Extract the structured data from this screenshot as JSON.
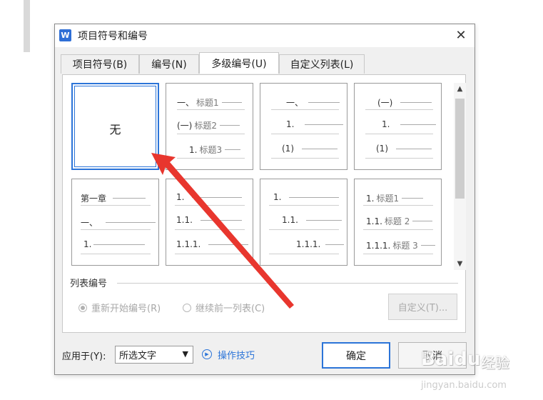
{
  "dialog": {
    "app_icon": "W",
    "title": "项目符号和编号",
    "close": "✕"
  },
  "tabs": [
    {
      "label": "项目符号(B)",
      "active": false
    },
    {
      "label": "编号(N)",
      "active": false
    },
    {
      "label": "多级编号(U)",
      "active": true
    },
    {
      "label": "自定义列表(L)",
      "active": false
    }
  ],
  "gallery": {
    "none_label": "无",
    "cell2": [
      "一、",
      "标题1",
      "(一)",
      "标题2",
      "1.",
      "标题3"
    ],
    "cell3": [
      "一、",
      "1.",
      "(1)"
    ],
    "cell4": [
      "(一)",
      "1.",
      "(1)"
    ],
    "cell5": [
      "第一章",
      "一、",
      "1."
    ],
    "cell6": [
      "1.",
      "1.1.",
      "1.1.1."
    ],
    "cell7": [
      "1.",
      "1.1.",
      "1.1.1."
    ],
    "cell8": [
      "1.",
      "标题1",
      "1.1.",
      "标题 2",
      "1.1.1.",
      "标题 3"
    ]
  },
  "list_numbering": {
    "section_label": "列表编号",
    "restart_label": "重新开始编号(R)",
    "continue_label": "继续前一列表(C)",
    "custom_button": "自定义(T)..."
  },
  "footer": {
    "apply_label": "应用于(Y):",
    "apply_value": "所选文字",
    "tips_label": "操作技巧",
    "ok_button": "确定",
    "cancel_button": "取消"
  },
  "watermark": {
    "logo": "Baidu",
    "cn": "经验",
    "url": "jingyan.baidu.com"
  },
  "colors": {
    "accent": "#2b74d8",
    "annotation_arrow": "#e8362e"
  }
}
